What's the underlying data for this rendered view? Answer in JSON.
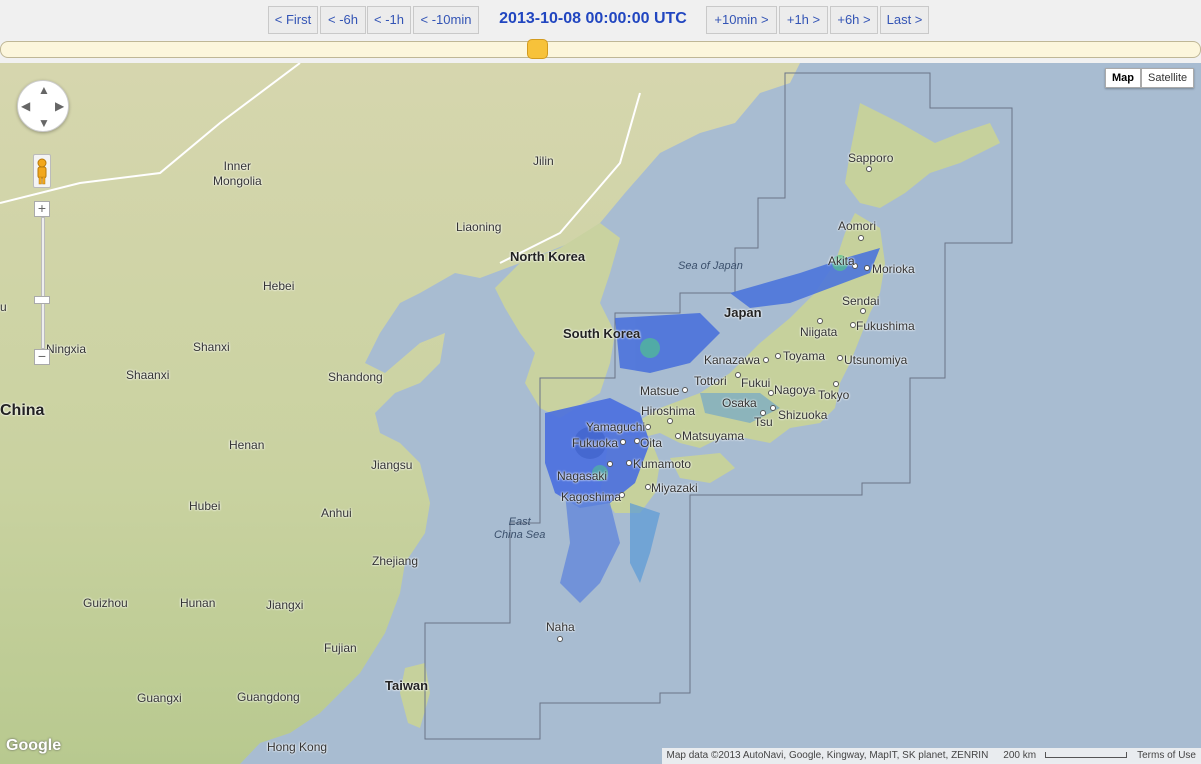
{
  "nav": {
    "first": "< First",
    "minus6h": "< -6h",
    "minus1h": "< -1h",
    "minus10min": "< -10min",
    "timestamp": "2013-10-08 00:00:00 UTC",
    "plus10min": "+10min >",
    "plus1h": "+1h >",
    "plus6h": "+6h >",
    "last": "Last >"
  },
  "slider": {
    "position_fraction": 0.447
  },
  "map_type": {
    "map": "Map",
    "satellite": "Satellite",
    "selected": "Map"
  },
  "attribution": {
    "data": "Map data ©2013 AutoNavi, Google, Kingway, MapIT, SK planet, ZENRIN",
    "scale": "200 km",
    "terms": "Terms of Use"
  },
  "logo": "Google",
  "labels": {
    "china": "China",
    "inner_mongolia_1": "Inner",
    "inner_mongolia_2": "Mongolia",
    "jilin": "Jilin",
    "liaoning": "Liaoning",
    "north_korea": "North Korea",
    "south_korea": "South Korea",
    "sea_of_japan": "Sea of Japan",
    "japan": "Japan",
    "hebei": "Hebei",
    "ningxia": "Ningxia",
    "shanxi": "Shanxi",
    "shaanxi": "Shaanxi",
    "shandong": "Shandong",
    "henan": "Henan",
    "jiangsu": "Jiangsu",
    "hubei": "Hubei",
    "anhui": "Anhui",
    "zhejiang": "Zhejiang",
    "guizhou": "Guizhou",
    "hunan": "Hunan",
    "jiangxi": "Jiangxi",
    "fujian": "Fujian",
    "guangxi": "Guangxi",
    "guangdong": "Guangdong",
    "taiwan": "Taiwan",
    "hong_kong": "Hong Kong",
    "east_china_sea_1": "East",
    "east_china_sea_2": "China Sea",
    "edge_u": "u"
  },
  "cities": {
    "sapporo": "Sapporo",
    "aomori": "Aomori",
    "akita": "Akita",
    "morioka": "Morioka",
    "sendai": "Sendai",
    "niigata": "Niigata",
    "fukushima": "Fukushima",
    "kanazawa": "Kanazawa",
    "toyama": "Toyama",
    "utsunomiya": "Utsunomiya",
    "tottori": "Tottori",
    "fukui": "Fukui",
    "matsue": "Matsue",
    "nagoya": "Nagoya",
    "tokyo": "Tokyo",
    "osaka": "Osaka",
    "hiroshima": "Hiroshima",
    "shizuoka": "Shizuoka",
    "tsu": "Tsu",
    "yamaguchi": "Yamaguchi",
    "fukuoka": "Fukuoka",
    "oita": "Oita",
    "matsuyama": "Matsuyama",
    "kumamoto": "Kumamoto",
    "nagasaki": "Nagasaki",
    "miyazaki": "Miyazaki",
    "kagoshima": "Kagoshima",
    "naha": "Naha"
  },
  "colors": {
    "sea": "#a8bcd1",
    "land": "#d9dab1",
    "radar_light": "#5b9bd6",
    "radar_mid": "#3b5fd0",
    "radar_high": "#47c28a",
    "timestamp": "#2146c0"
  }
}
